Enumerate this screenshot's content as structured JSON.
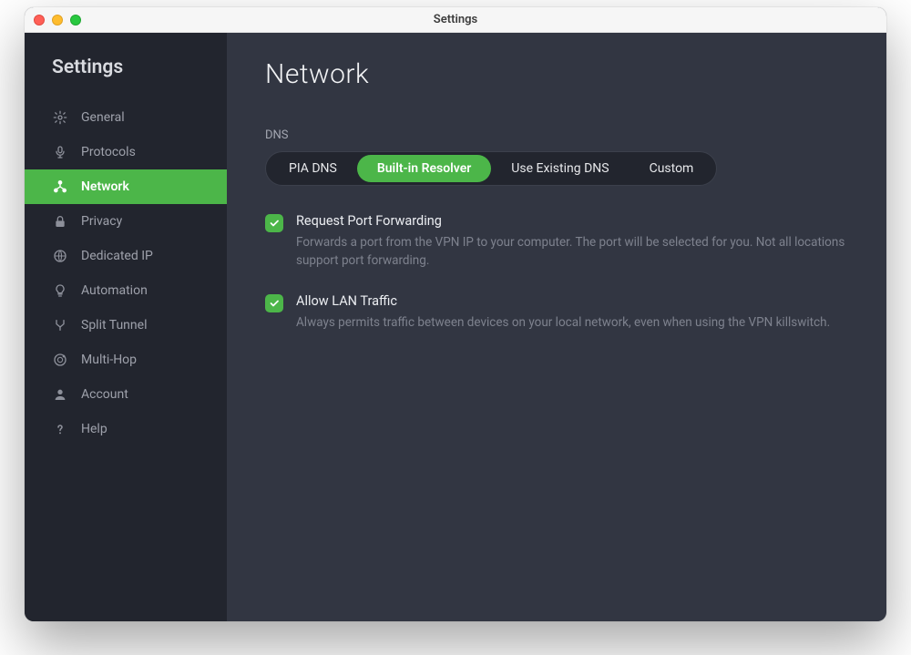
{
  "colors": {
    "accent": "#4cb649",
    "sidebarBg": "#22252e",
    "mainBg": "#323642"
  },
  "titlebar": {
    "title": "Settings"
  },
  "sidebar": {
    "title": "Settings",
    "items": [
      {
        "label": "General",
        "icon": "gear-icon",
        "active": false
      },
      {
        "label": "Protocols",
        "icon": "protocols-icon",
        "active": false
      },
      {
        "label": "Network",
        "icon": "network-icon",
        "active": true
      },
      {
        "label": "Privacy",
        "icon": "lock-icon",
        "active": false
      },
      {
        "label": "Dedicated IP",
        "icon": "globe-ip-icon",
        "active": false
      },
      {
        "label": "Automation",
        "icon": "lightbulb-icon",
        "active": false
      },
      {
        "label": "Split Tunnel",
        "icon": "split-icon",
        "active": false
      },
      {
        "label": "Multi-Hop",
        "icon": "multihop-icon",
        "active": false
      },
      {
        "label": "Account",
        "icon": "account-icon",
        "active": false
      },
      {
        "label": "Help",
        "icon": "help-icon",
        "active": false
      }
    ]
  },
  "main": {
    "title": "Network",
    "dns": {
      "label": "DNS",
      "options": [
        {
          "label": "PIA DNS",
          "active": false
        },
        {
          "label": "Built-in Resolver",
          "active": true
        },
        {
          "label": "Use Existing DNS",
          "active": false
        },
        {
          "label": "Custom",
          "active": false
        }
      ]
    },
    "checks": [
      {
        "title": "Request Port Forwarding",
        "desc": "Forwards a port from the VPN IP to your computer. The port will be selected for you. Not all locations support port forwarding.",
        "checked": true
      },
      {
        "title": "Allow LAN Traffic",
        "desc": "Always permits traffic between devices on your local network, even when using the VPN killswitch.",
        "checked": true
      }
    ]
  }
}
